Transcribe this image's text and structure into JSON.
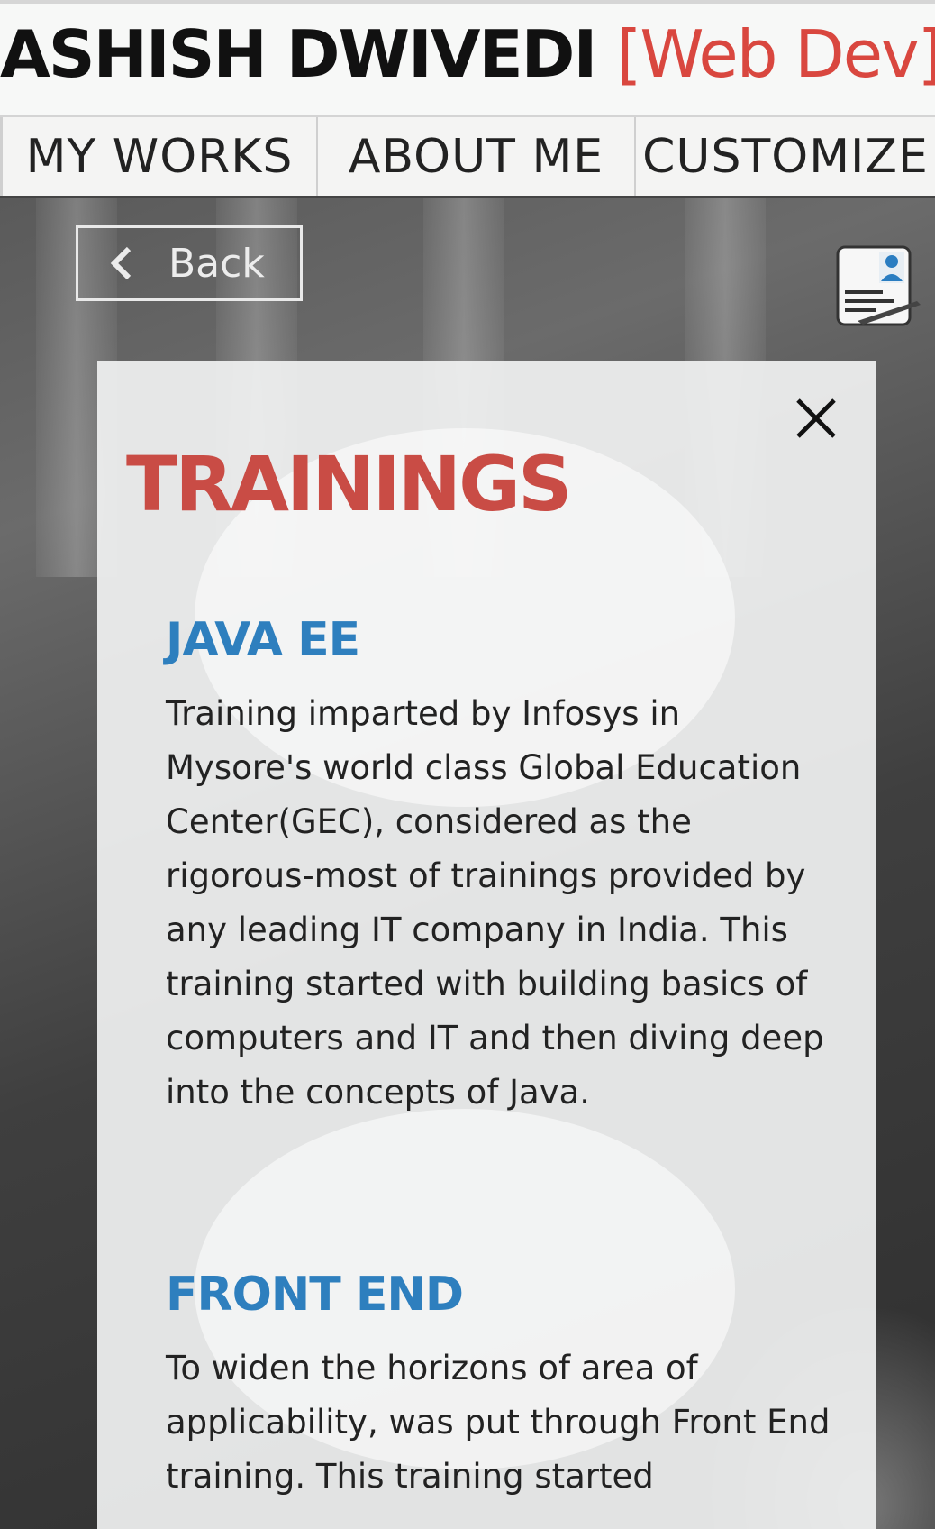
{
  "header": {
    "name": "ASHISH DWIVEDI",
    "role": "[Web Dev]"
  },
  "nav": {
    "items": [
      {
        "label": "MY WORKS"
      },
      {
        "label": "ABOUT ME"
      },
      {
        "label": "CUSTOMIZE"
      }
    ]
  },
  "back_button": {
    "label": "Back",
    "icon": "chevron-left-icon"
  },
  "resume_button": {
    "icon": "resume-document-icon"
  },
  "modal": {
    "title": "TRAININGS",
    "close_icon": "close-icon",
    "sections": [
      {
        "title": "JAVA EE",
        "body": "Training imparted by Infosys in Mysore's world class Global Education Center(GEC), considered as the rigorous-most of trainings provided by any leading IT company in India. This training started with building basics of computers and IT and then diving deep into the concepts of Java."
      },
      {
        "title": "FRONT END",
        "body": "To widen the horizons of area of applicability, was put through Front End training. This training started"
      }
    ]
  },
  "colors": {
    "accent_red": "#d9473f",
    "title_red": "#c94c45",
    "section_blue": "#2e7fbe"
  }
}
